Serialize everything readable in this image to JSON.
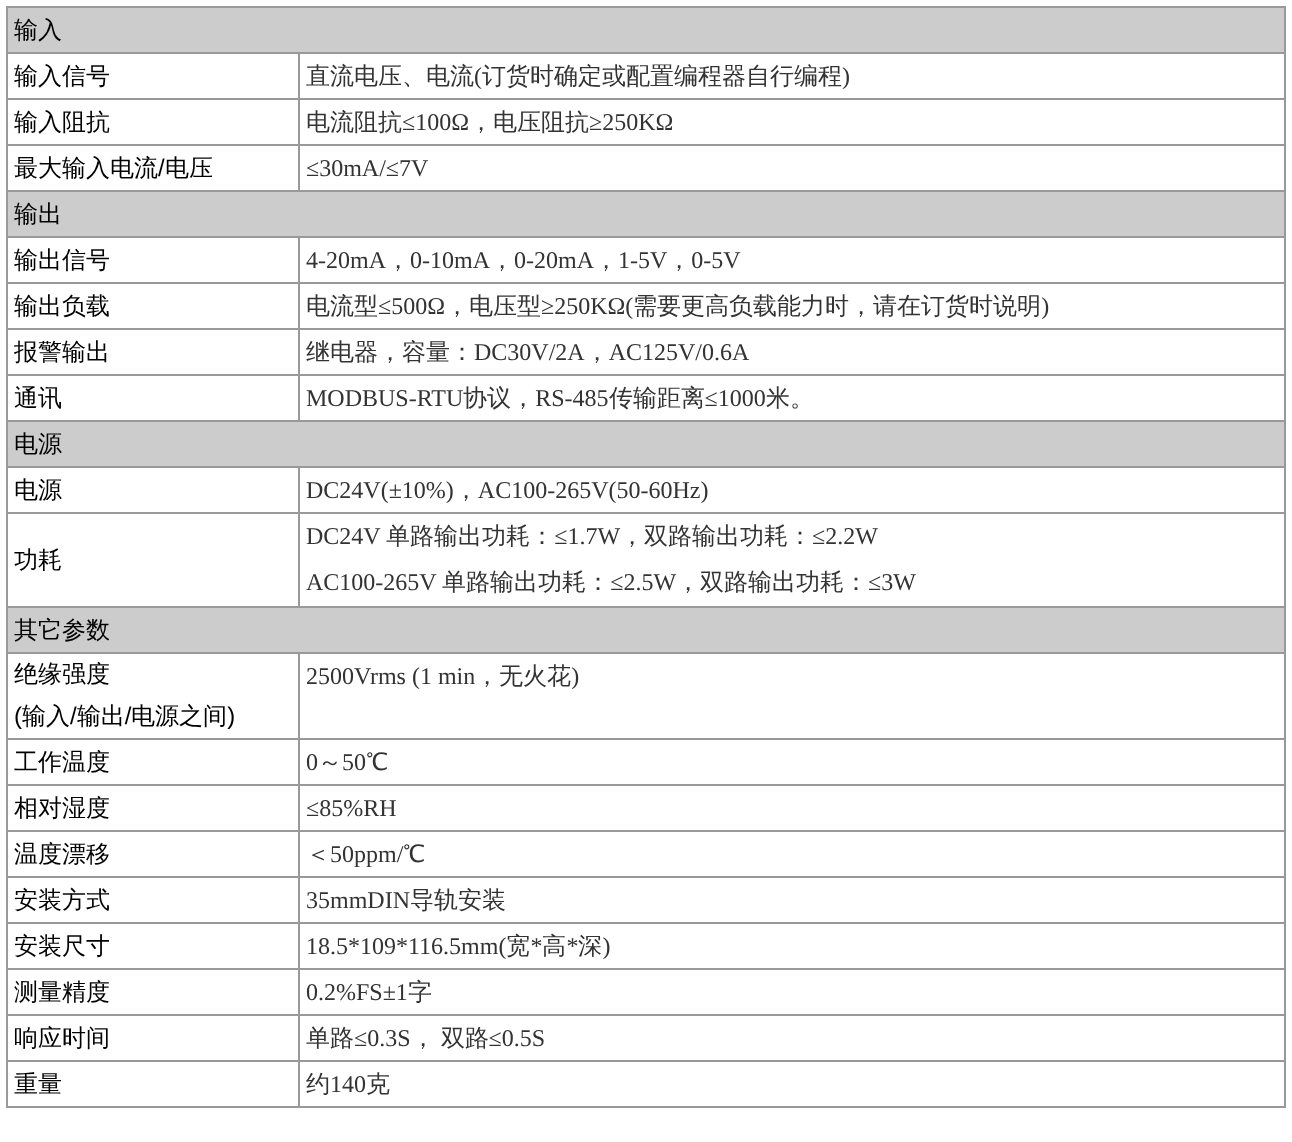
{
  "sections": [
    {
      "title": "输入",
      "rows": [
        {
          "label": [
            "输入信号"
          ],
          "value": [
            "直流电压、电流(订货时确定或配置编程器自行编程)"
          ]
        },
        {
          "label": [
            "输入阻抗"
          ],
          "value": [
            "电流阻抗≤100Ω，电压阻抗≥250KΩ"
          ]
        },
        {
          "label": [
            "最大输入电流/电压"
          ],
          "value": [
            "≤30mA/≤7V"
          ]
        }
      ]
    },
    {
      "title": "输出",
      "rows": [
        {
          "label": [
            "输出信号"
          ],
          "value": [
            "4-20mA，0-10mA，0-20mA，1-5V，0-5V"
          ]
        },
        {
          "label": [
            "输出负载"
          ],
          "value": [
            "电流型≤500Ω，电压型≥250KΩ(需要更高负载能力时，请在订货时说明)"
          ]
        },
        {
          "label": [
            "报警输出"
          ],
          "value": [
            "继电器，容量：DC30V/2A，AC125V/0.6A"
          ]
        },
        {
          "label": [
            "通讯"
          ],
          "value": [
            "MODBUS-RTU协议，RS-485传输距离≤1000米。"
          ]
        }
      ]
    },
    {
      "title": "电源",
      "rows": [
        {
          "label": [
            "电源"
          ],
          "value": [
            "DC24V(±10%)，AC100-265V(50-60Hz)"
          ]
        },
        {
          "label": [
            "功耗"
          ],
          "value": [
            "DC24V 单路输出功耗：≤1.7W，双路输出功耗：≤2.2W",
            "AC100-265V 单路输出功耗：≤2.5W，双路输出功耗：≤3W"
          ]
        }
      ]
    },
    {
      "title": "其它参数",
      "rows": [
        {
          "label": [
            "绝缘强度",
            "(输入/输出/电源之间)"
          ],
          "value": [
            "2500Vrms (1 min，无火花)"
          ]
        },
        {
          "label": [
            "工作温度"
          ],
          "value": [
            "0～50℃"
          ]
        },
        {
          "label": [
            "相对湿度"
          ],
          "value": [
            "≤85%RH"
          ]
        },
        {
          "label": [
            "温度漂移"
          ],
          "value": [
            "＜50ppm/℃"
          ]
        },
        {
          "label": [
            "安装方式"
          ],
          "value": [
            "35mmDIN导轨安装"
          ]
        },
        {
          "label": [
            "安装尺寸"
          ],
          "value": [
            "18.5*109*116.5mm(宽*高*深)"
          ]
        },
        {
          "label": [
            "测量精度"
          ],
          "value": [
            "0.2%FS±1字"
          ]
        },
        {
          "label": [
            "响应时间"
          ],
          "value": [
            "单路≤0.3S，  双路≤0.5S"
          ]
        },
        {
          "label": [
            "重量"
          ],
          "value": [
            "约140克"
          ]
        }
      ]
    }
  ]
}
